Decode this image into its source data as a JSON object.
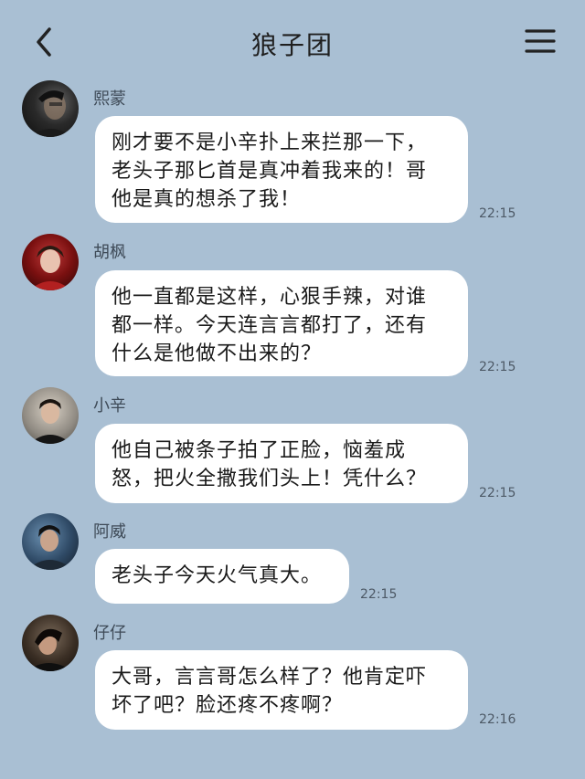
{
  "header": {
    "title": "狼子团"
  },
  "messages": [
    {
      "sender": "熙蒙",
      "text": "刚才要不是小辛扑上来拦那一下，\n老头子那匕首是真冲着我来的！哥\n他是真的想杀了我！",
      "time": "22:15"
    },
    {
      "sender": "胡枫",
      "text": "他一直都是这样，心狠手辣，对谁\n都一样。今天连言言都打了，还有\n什么是他做不出来的？",
      "time": "22:15"
    },
    {
      "sender": "小辛",
      "text": "他自己被条子拍了正脸，恼羞成\n怒，把火全撒我们头上！凭什么？",
      "time": "22:15"
    },
    {
      "sender": "阿威",
      "text": "老头子今天火气真大。",
      "time": "22:15"
    },
    {
      "sender": "仔仔",
      "text": "大哥，言言哥怎么样了？他肯定吓\n坏了吧？脸还疼不疼啊？",
      "time": "22:16"
    }
  ],
  "colors": {
    "background": "#a9bfd3",
    "bubble": "#ffffff"
  }
}
